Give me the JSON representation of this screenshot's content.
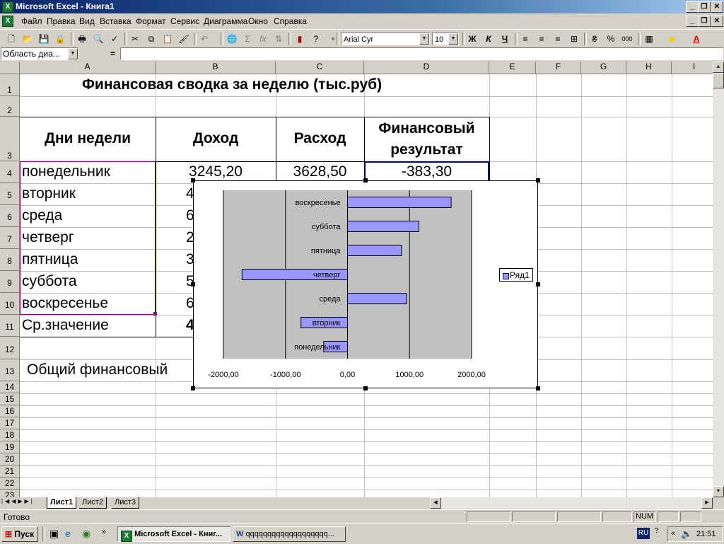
{
  "window": {
    "title": "Microsoft Excel - Книга1",
    "app_icon": "excel-icon"
  },
  "menu": [
    "Файл",
    "Правка",
    "Вид",
    "Вставка",
    "Формат",
    "Сервис",
    "Диаграмма",
    "Окно",
    "Справка"
  ],
  "toolbar": {
    "font_name": "Arial Cyr",
    "font_size": "10",
    "bold": "Ж",
    "italic": "К",
    "underline": "Ч",
    "percent": "%",
    "thousands": "000",
    "sum": "Σ",
    "fx": "fx"
  },
  "formula_bar": {
    "name_box": "Область диа...",
    "equals": "=",
    "content": ""
  },
  "columns": [
    "A",
    "B",
    "C",
    "D",
    "E",
    "F",
    "G",
    "H",
    "I"
  ],
  "rows": [
    "1",
    "2",
    "3",
    "4",
    "5",
    "6",
    "7",
    "8",
    "9",
    "10",
    "11",
    "12",
    "13",
    "14",
    "15",
    "16",
    "17",
    "18",
    "19",
    "20",
    "21",
    "22",
    "23"
  ],
  "sheet": {
    "title": "Финансовая сводка за неделю (тыс.руб)",
    "headers": {
      "days": "Дни недели",
      "income": "Доход",
      "expense": "Расход",
      "result_line1": "Финансовый",
      "result_line2": "результат"
    },
    "row4": {
      "day": "понедельник",
      "income": "3245,20",
      "expense": "3628,50",
      "result": "-383,30"
    },
    "days": [
      "вторник",
      "среда",
      "четверг",
      "пятница",
      "суббота",
      "воскресенье"
    ],
    "income_partial": [
      "4",
      "6",
      "2",
      "3",
      "5",
      "6"
    ],
    "average_label": "Ср.значение",
    "average_partial": "4",
    "total_label": "Общий финансовый"
  },
  "chart_data": {
    "type": "bar",
    "orientation": "horizontal",
    "categories": [
      "понедельник",
      "вторник",
      "среда",
      "четверг",
      "пятница",
      "суббота",
      "воскресенье"
    ],
    "series": [
      {
        "name": "Ряд1",
        "values": [
          -383.3,
          -750,
          950,
          -1700,
          870,
          1150,
          1670
        ]
      }
    ],
    "xlim": [
      -2000,
      2000
    ],
    "x_ticks": [
      "-2000,00",
      "-1000,00",
      "0,00",
      "1000,00",
      "2000,00"
    ],
    "grid": true,
    "legend": "right",
    "colors": {
      "bar": "#9999ff",
      "plot_bg": "#c0c0c0"
    }
  },
  "sheet_tabs": [
    "Лист1",
    "Лист2",
    "Лист3"
  ],
  "status": {
    "ready": "Готово",
    "num": "NUM"
  },
  "taskbar": {
    "start": "Пуск",
    "tasks": [
      "Microsoft Excel - Книг...",
      "qqqqqqqqqqqqqqqqqqq..."
    ],
    "lang": "RU",
    "time": "21:51"
  }
}
